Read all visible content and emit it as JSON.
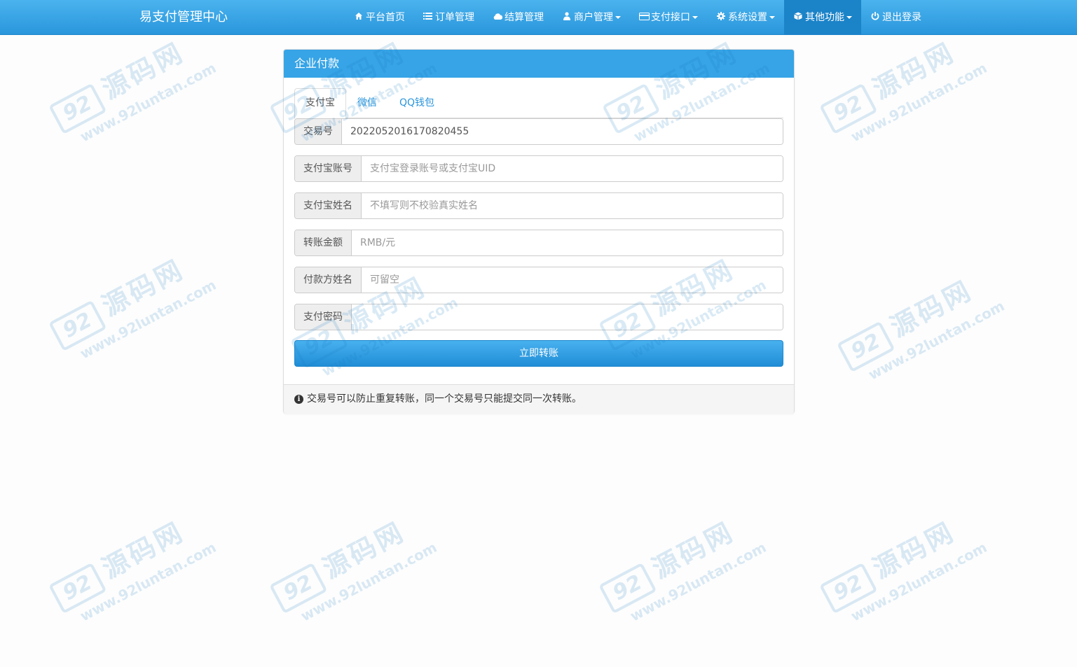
{
  "navbar": {
    "brand": "易支付管理中心",
    "items": [
      {
        "label": "平台首页",
        "icon": "home-icon",
        "dropdown": false,
        "active": false
      },
      {
        "label": "订单管理",
        "icon": "list-icon",
        "dropdown": false,
        "active": false
      },
      {
        "label": "结算管理",
        "icon": "cloud-icon",
        "dropdown": false,
        "active": false
      },
      {
        "label": "商户管理",
        "icon": "user-icon",
        "dropdown": true,
        "active": false
      },
      {
        "label": "支付接口",
        "icon": "credit-card-icon",
        "dropdown": true,
        "active": false
      },
      {
        "label": "系统设置",
        "icon": "gear-icon",
        "dropdown": true,
        "active": false
      },
      {
        "label": "其他功能",
        "icon": "cube-icon",
        "dropdown": true,
        "active": true
      },
      {
        "label": "退出登录",
        "icon": "power-icon",
        "dropdown": false,
        "active": false
      }
    ]
  },
  "panel": {
    "title": "企业付款",
    "tabs": [
      {
        "label": "支付宝",
        "active": true
      },
      {
        "label": "微信",
        "active": false
      },
      {
        "label": "QQ钱包",
        "active": false
      }
    ],
    "fields": [
      {
        "label": "交易号",
        "value": "2022052016170820455",
        "placeholder": ""
      },
      {
        "label": "支付宝账号",
        "value": "",
        "placeholder": "支付宝登录账号或支付宝UID"
      },
      {
        "label": "支付宝姓名",
        "value": "",
        "placeholder": "不填写则不校验真实姓名"
      },
      {
        "label": "转账金额",
        "value": "",
        "placeholder": "RMB/元"
      },
      {
        "label": "付款方姓名",
        "value": "",
        "placeholder": "可留空"
      },
      {
        "label": "支付密码",
        "value": "",
        "placeholder": ""
      }
    ],
    "submit_label": "立即转账",
    "footer_note": "交易号可以防止重复转账，同一个交易号只能提交同一次转账。"
  },
  "watermark": {
    "badge": "92",
    "name": "源码网",
    "url": "www.92luntan.com"
  },
  "colors": {
    "navbar": "#36a4e6",
    "nav_active": "#1b83c8",
    "panel_heading": "#36a4e6",
    "link": "#2a96dc"
  }
}
